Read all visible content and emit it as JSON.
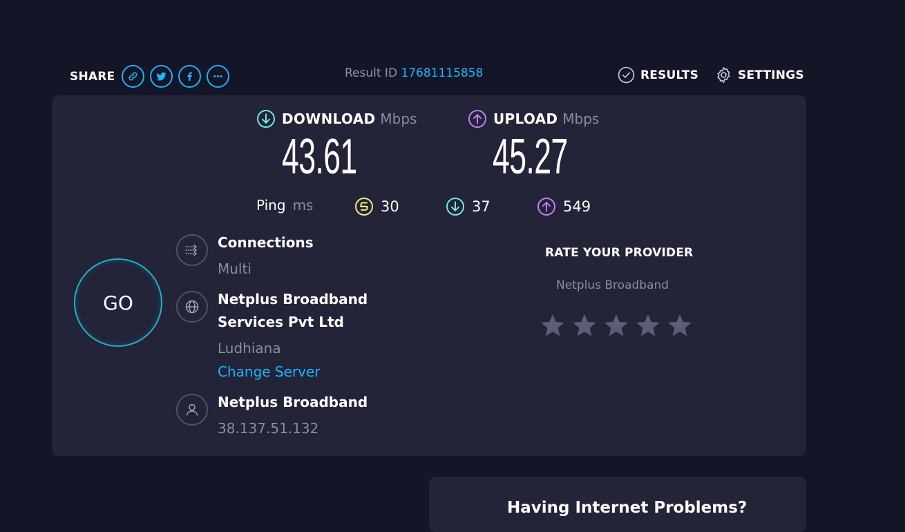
{
  "share": {
    "label": "SHARE",
    "icons": [
      "link-icon",
      "twitter-icon",
      "facebook-icon",
      "more-icon"
    ]
  },
  "result": {
    "label": "Result ID",
    "id": "17681115858"
  },
  "nav": {
    "results": "RESULTS",
    "settings": "SETTINGS"
  },
  "download": {
    "label": "DOWNLOAD",
    "unit": "Mbps",
    "value": "43.61"
  },
  "upload": {
    "label": "UPLOAD",
    "unit": "Mbps",
    "value": "45.27"
  },
  "ping": {
    "label": "Ping",
    "unit": "ms",
    "idle": "30",
    "download": "37",
    "upload": "549"
  },
  "go_label": "GO",
  "connections": {
    "title": "Connections",
    "value": "Multi"
  },
  "server": {
    "name_line1": "Netplus Broadband",
    "name_line2": "Services Pvt Ltd",
    "location": "Ludhiana",
    "change_label": "Change Server"
  },
  "isp": {
    "name": "Netplus Broadband",
    "ip": "38.137.51.132"
  },
  "rate": {
    "title": "RATE YOUR PROVIDER",
    "provider": "Netplus Broadband",
    "stars_total": 5,
    "stars_selected": 0
  },
  "help_card": {
    "title": "Having Internet Problems?"
  },
  "colors": {
    "background": "#141526",
    "card": "#232438",
    "accent_blue": "#1cb4ff",
    "download": "#6fe9e4",
    "upload": "#c47cf5",
    "ping": "#f5e876",
    "muted": "#8a8ca2",
    "star": "#5c5e78"
  }
}
